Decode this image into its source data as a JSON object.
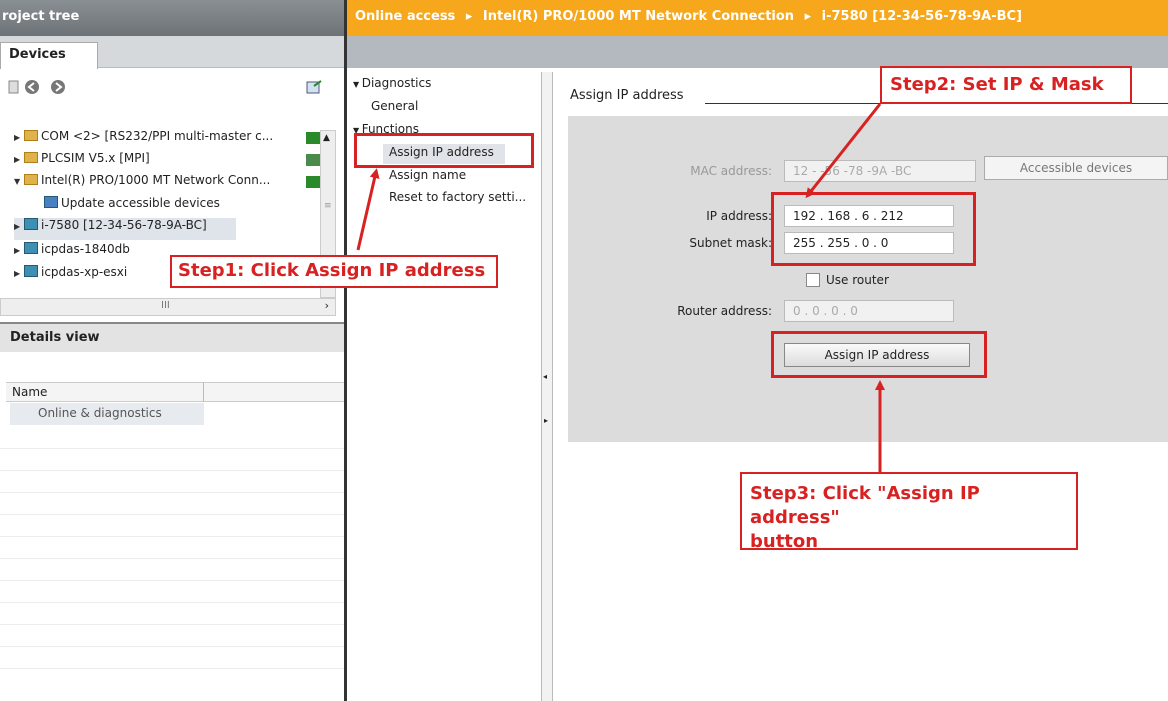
{
  "left_panel": {
    "title": "roject tree",
    "devices_tab": "Devices",
    "tree": [
      {
        "label": "COM <2> [RS232/PPI multi-master c...",
        "expanded": false
      },
      {
        "label": "PLCSIM V5.x [MPI]",
        "expanded": false
      },
      {
        "label": "Intel(R) PRO/1000 MT Network Conn...",
        "expanded": true
      },
      {
        "label": "Update accessible devices"
      },
      {
        "label": "i-7580 [12-34-56-78-9A-BC]",
        "expanded": false,
        "selected": true
      },
      {
        "label": "icpdas-1840db",
        "expanded": false
      },
      {
        "label": "icpdas-xp-esxi",
        "expanded": false
      }
    ],
    "scroll_mark": "III",
    "details_view": {
      "title": "Details view",
      "column_name": "Name",
      "row": "Online & diagnostics"
    }
  },
  "breadcrumb": {
    "items": [
      "Online access",
      "Intel(R) PRO/1000 MT Network Connection",
      "i-7580 [12-34-56-78-9A-BC]"
    ],
    "separator": "▸"
  },
  "nav": {
    "diagnostics": "Diagnostics",
    "general": "General",
    "functions": "Functions",
    "assign_ip": "Assign IP address",
    "assign_name": "Assign name",
    "reset": "Reset to factory setti..."
  },
  "form": {
    "section_title": "Assign IP address",
    "mac_label": "MAC address:",
    "mac_value": "12 -  -56 -78 -9A -BC",
    "accessible_devices": "Accessible devices",
    "ip_label": "IP address:",
    "ip_value": "192 . 168 . 6    . 212",
    "mask_label": "Subnet mask:",
    "mask_value": "255 . 255 . 0    . 0",
    "use_router": "Use router",
    "router_label": "Router address:",
    "router_value": "0    . 0    . 0    . 0",
    "assign_button": "Assign IP address"
  },
  "callouts": {
    "step1": "Step1: Click Assign IP address",
    "step2": "Step2: Set IP & Mask",
    "step3_line1": "Step3: Click \"Assign IP address\"",
    "step3_line2": "button"
  },
  "colors": {
    "accent_orange": "#f6a71b",
    "annotation_red": "#d82222"
  }
}
